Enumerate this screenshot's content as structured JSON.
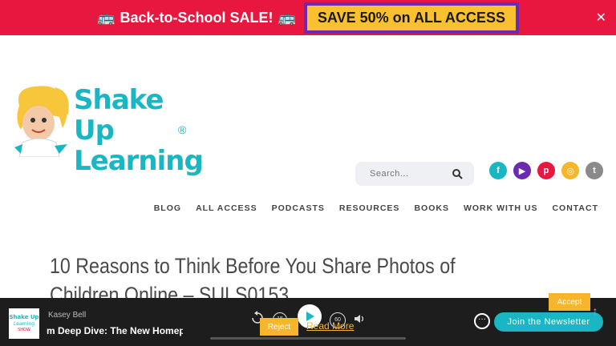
{
  "promo": {
    "text": "Back-to-School SALE!",
    "cta": "SAVE 50% on ALL ACCESS",
    "close": "✕"
  },
  "logo": {
    "line1": "Shake Up",
    "line2": "Learning",
    "reg": "®"
  },
  "search": {
    "placeholder": "Search..."
  },
  "social": [
    {
      "name": "facebook",
      "glyph": "f",
      "color": "#1ab6c3"
    },
    {
      "name": "youtube",
      "glyph": "▶",
      "color": "#6a2bb0"
    },
    {
      "name": "pinterest",
      "glyph": "p",
      "color": "#e8173f"
    },
    {
      "name": "instagram",
      "glyph": "◎",
      "color": "#f7b52b"
    },
    {
      "name": "twitter",
      "glyph": "t",
      "color": "#8a8a8a"
    }
  ],
  "nav": [
    "BLOG",
    "ALL ACCESS",
    "PODCASTS",
    "RESOURCES",
    "BOOKS",
    "WORK WITH US",
    "CONTACT"
  ],
  "article": {
    "title_line1": "10 Reasons to Think Before You Share Photos of",
    "title_line2": "Children Online – SULS0153"
  },
  "player": {
    "host": "Kasey Bell",
    "episode": "m Deep Dive: The New Homepag",
    "rewind": "15",
    "forward": "60",
    "newsletter": "Join the Newsletter"
  },
  "cookie": {
    "reject": "Reject",
    "read_more": "Read More",
    "accept": "Accept"
  }
}
